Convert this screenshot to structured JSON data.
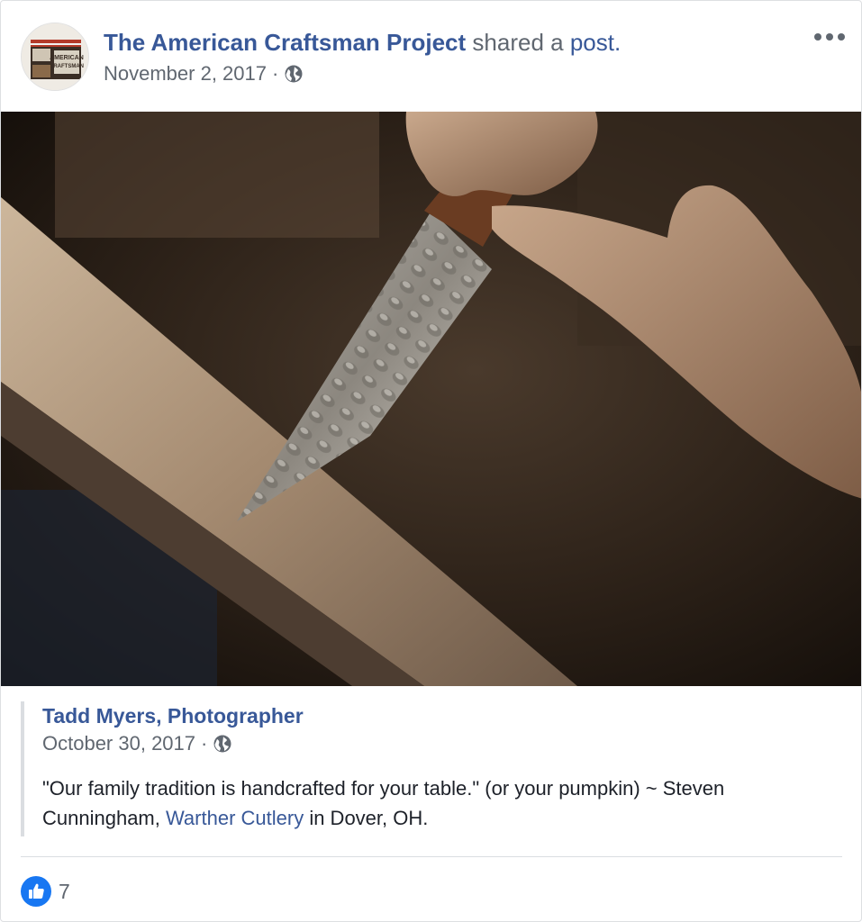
{
  "header": {
    "page_name": "The American Craftsman Project",
    "action_text": "shared a",
    "post_link": "post.",
    "date": "November 2, 2017",
    "separator": "·",
    "avatar_text_top": "AMERICAN",
    "avatar_text_bottom": "CRAFTSMAN"
  },
  "shared_post": {
    "author": "Tadd Myers, Photographer",
    "date": "October 30, 2017",
    "separator": "·",
    "text_before": "\"Our family tradition is handcrafted for your table.\" (or your pumpkin) ~ Steven Cunningham, ",
    "text_link": "Warther Cutlery",
    "text_after": " in Dover, OH."
  },
  "reactions": {
    "like_count": "7"
  },
  "colors": {
    "link": "#385898",
    "secondary_text": "#606770",
    "like_blue": "#1877f2"
  },
  "icons": {
    "privacy": "globe-icon",
    "menu": "more-options-icon",
    "reaction": "thumbs-up-icon"
  }
}
